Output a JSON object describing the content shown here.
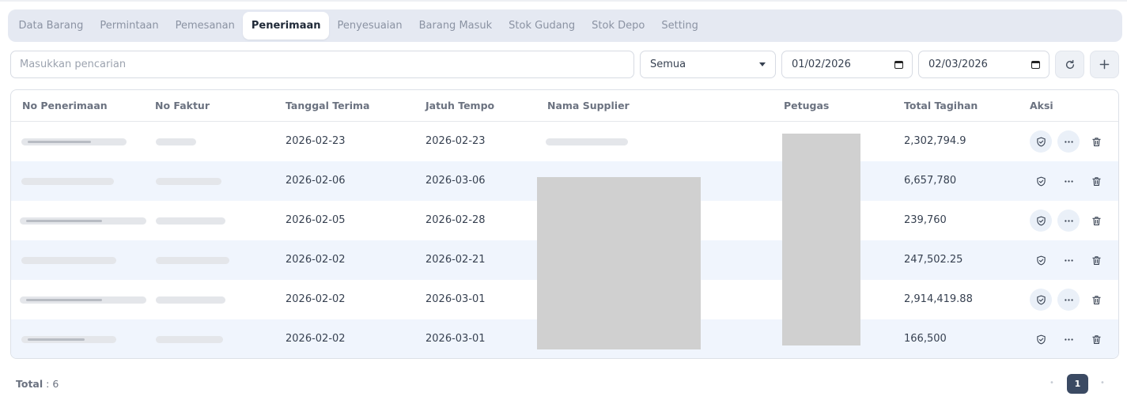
{
  "tabs": [
    {
      "label": "Data Barang",
      "active": false
    },
    {
      "label": "Permintaan",
      "active": false
    },
    {
      "label": "Pemesanan",
      "active": false
    },
    {
      "label": "Penerimaan",
      "active": true
    },
    {
      "label": "Penyesuaian",
      "active": false
    },
    {
      "label": "Barang Masuk",
      "active": false
    },
    {
      "label": "Stok Gudang",
      "active": false
    },
    {
      "label": "Stok Depo",
      "active": false
    },
    {
      "label": "Setting",
      "active": false
    }
  ],
  "filters": {
    "search_placeholder": "Masukkan pencarian",
    "status_selected": "Semua",
    "date_from": "01/02/2026",
    "date_to": "02/03/2026"
  },
  "table": {
    "headers": [
      "No Penerimaan",
      "No Faktur",
      "Tanggal Terima",
      "Jatuh Tempo",
      "Nama Supplier",
      "Petugas",
      "Total Tagihan",
      "Aksi"
    ],
    "rows": [
      {
        "tanggal_terima": "2026-02-23",
        "jatuh_tempo": "2026-02-23",
        "total_tagihan": "2,302,794.9"
      },
      {
        "tanggal_terima": "2026-02-06",
        "jatuh_tempo": "2026-03-06",
        "total_tagihan": "6,657,780"
      },
      {
        "tanggal_terima": "2026-02-05",
        "jatuh_tempo": "2026-02-28",
        "total_tagihan": "239,760"
      },
      {
        "tanggal_terima": "2026-02-02",
        "jatuh_tempo": "2026-02-21",
        "total_tagihan": "247,502.25"
      },
      {
        "tanggal_terima": "2026-02-02",
        "jatuh_tempo": "2026-03-01",
        "total_tagihan": "2,914,419.88"
      },
      {
        "tanggal_terima": "2026-02-02",
        "jatuh_tempo": "2026-03-01",
        "total_tagihan": "166,500"
      }
    ]
  },
  "footer": {
    "total_label": "Total",
    "total_value": ": 6",
    "current_page": "1"
  },
  "icons": {
    "refresh": "refresh-icon",
    "add": "plus-icon",
    "approve": "shield-check-icon",
    "more": "more-horizontal-icon",
    "delete": "trash-icon"
  },
  "colors": {
    "tab_bar_bg": "#e5e9f2",
    "row_alt_bg": "#f0f5fd",
    "pager_active": "#3b4a63"
  }
}
